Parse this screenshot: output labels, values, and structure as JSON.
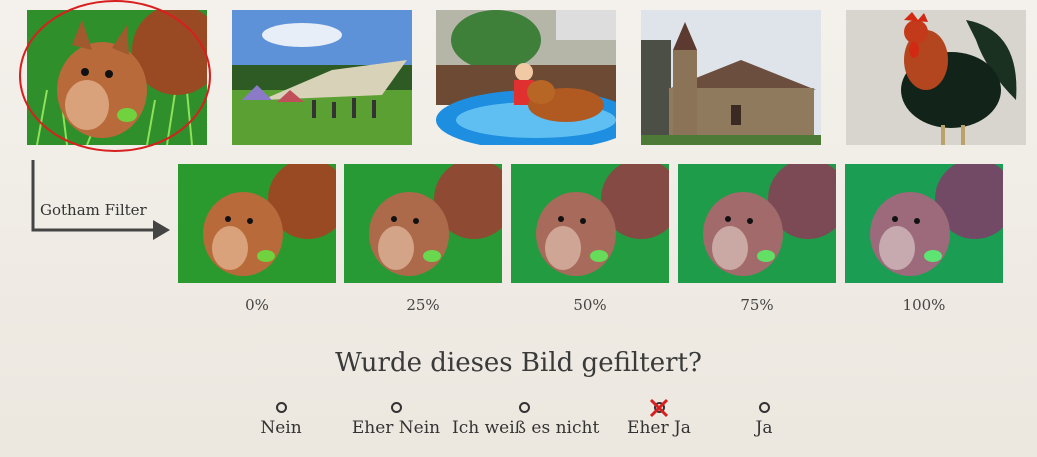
{
  "gallery": {
    "images": [
      {
        "name": "squirrel",
        "selected": true
      },
      {
        "name": "tent-camp"
      },
      {
        "name": "child-dog-pool"
      },
      {
        "name": "church"
      },
      {
        "name": "rooster"
      }
    ]
  },
  "filter": {
    "label": "Gotham Filter",
    "steps": [
      "0%",
      "25%",
      "50%",
      "75%",
      "100%"
    ]
  },
  "question": {
    "text": "Wurde dieses Bild gefiltert?",
    "options": [
      {
        "label": "Nein",
        "selected": false
      },
      {
        "label": "Eher Nein",
        "selected": false
      },
      {
        "label": "Ich weiß es nicht",
        "selected": false
      },
      {
        "label": "Eher Ja",
        "selected": true
      },
      {
        "label": "Ja",
        "selected": false
      }
    ]
  },
  "colors": {
    "selection": "#d81f1f",
    "grass": "#3aa52a",
    "fur": "#b86a3a"
  }
}
